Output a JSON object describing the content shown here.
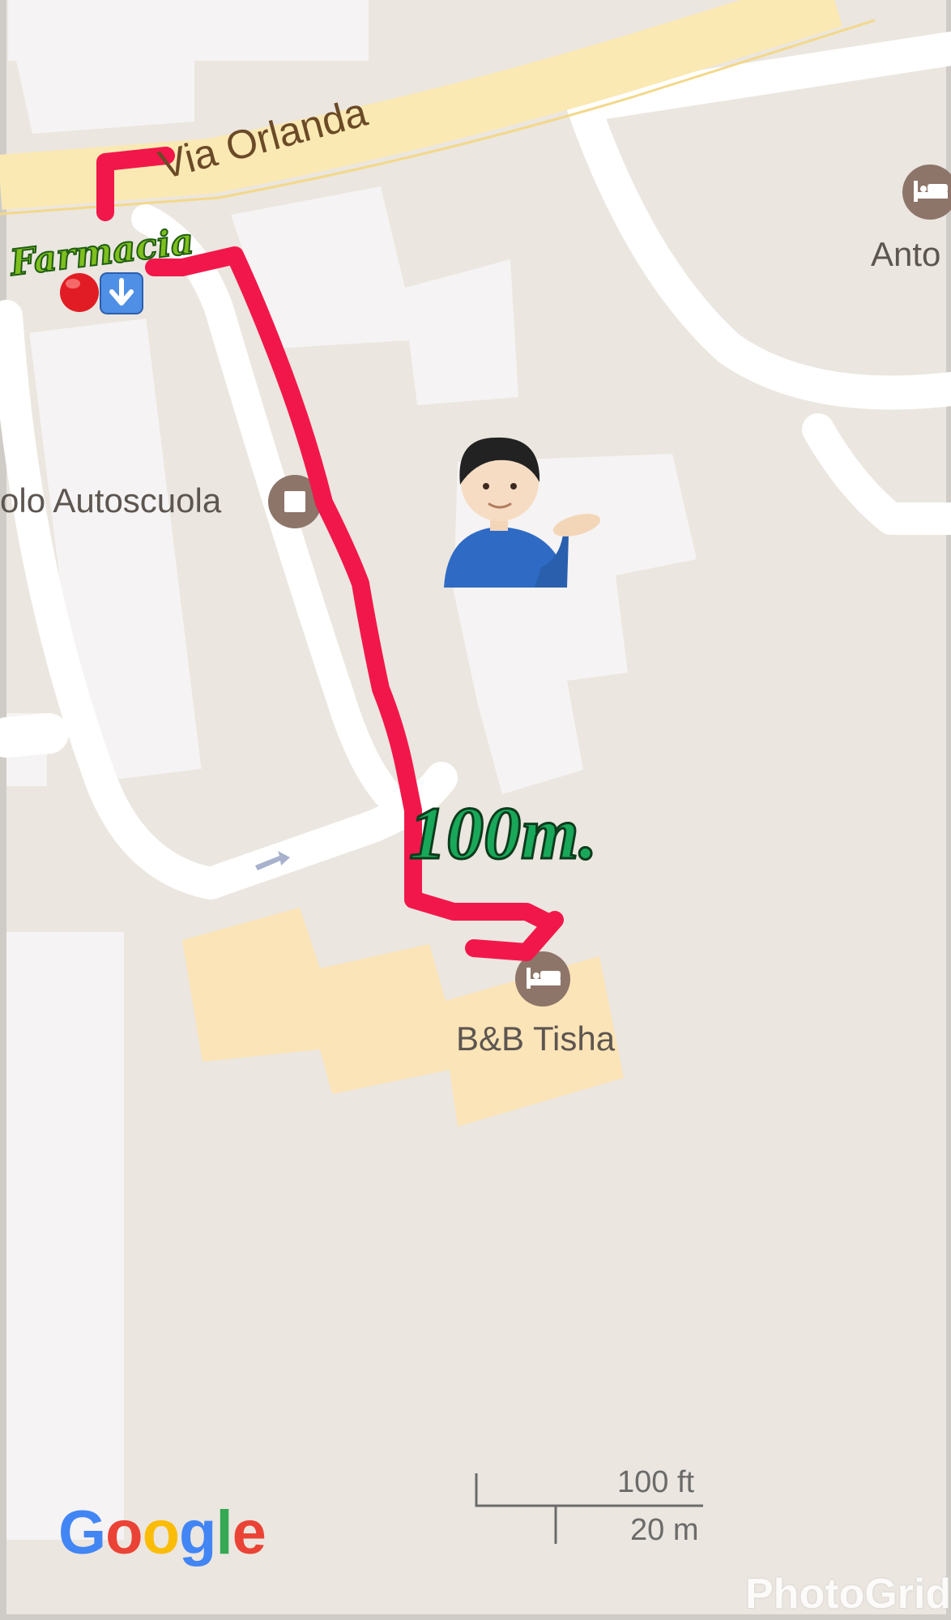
{
  "map": {
    "street_label": "Via Orlanda",
    "pois": {
      "hotel_top_right": "Anto",
      "autoscuola": "olo Autoscuola",
      "bnb": "B&B Tisha"
    },
    "annotations": {
      "start": "Farmacia",
      "distance": "100m."
    },
    "scale": {
      "imperial": "100 ft",
      "metric": "20 m"
    },
    "attribution": {
      "letters": [
        "G",
        "o",
        "o",
        "g",
        "l",
        "e"
      ],
      "colors": [
        "#4285F4",
        "#EA4335",
        "#FBBC05",
        "#4285F4",
        "#34A853",
        "#EA4335"
      ]
    },
    "watermark": "PhotoGrid",
    "icons": [
      "hotel-icon",
      "school-icon",
      "hotel-icon",
      "red-circle-icon",
      "down-arrow-button-icon",
      "person-tipping-hand-icon",
      "direction-arrow-icon"
    ],
    "colors": {
      "land": "#ebe6df",
      "road": "#ffffff",
      "main_road": "#fbe9b3",
      "building": "#f5f3f3",
      "highlight_building": "#fbe4b7",
      "poi_marker": "#8d7569",
      "route": "#f2174a",
      "distance_text": "#19a85a"
    }
  }
}
